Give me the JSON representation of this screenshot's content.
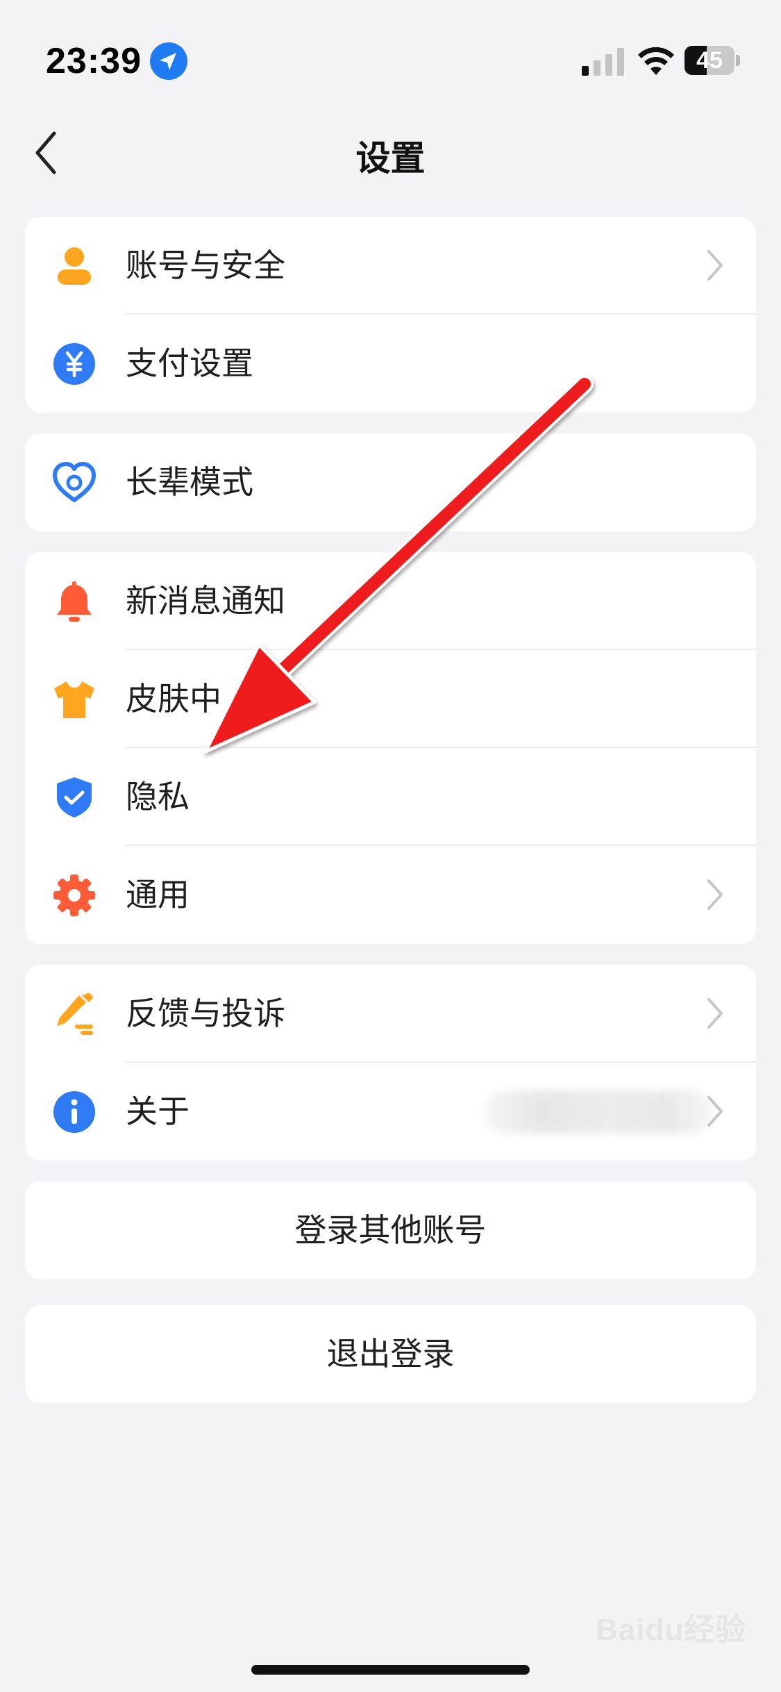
{
  "status_bar": {
    "time": "23:39",
    "battery_level": "45",
    "battery_fraction": 0.45,
    "icons": [
      "location-arrow-icon",
      "cellular-signal-icon",
      "wifi-icon",
      "battery-icon"
    ]
  },
  "nav": {
    "title": "设置",
    "back_icon": "chevron-left-icon"
  },
  "groups": [
    {
      "items": [
        {
          "label": "账号与安全",
          "icon": "person-icon",
          "icon_color": "#ffa51f",
          "chevron": true
        },
        {
          "label": "支付设置",
          "icon": "yuan-icon",
          "icon_color": "#2f7bf5",
          "chevron": false
        }
      ]
    },
    {
      "items": [
        {
          "label": "长辈模式",
          "icon": "heart-icon",
          "icon_color": "#2f7bf5",
          "chevron": false
        }
      ]
    },
    {
      "items": [
        {
          "label": "新消息通知",
          "icon": "bell-icon",
          "icon_color": "#ff5b36",
          "chevron": false
        },
        {
          "label": "皮肤中",
          "icon": "tshirt-icon",
          "icon_color": "#ffa51f",
          "chevron": false
        },
        {
          "label": "隐私",
          "icon": "shield-check-icon",
          "icon_color": "#2f7bf5",
          "chevron": false
        },
        {
          "label": "通用",
          "icon": "gear-icon",
          "icon_color": "#ff5b36",
          "chevron": true
        }
      ]
    },
    {
      "items": [
        {
          "label": "反馈与投诉",
          "icon": "pencil-icon",
          "icon_color": "#ffa51f",
          "chevron": true
        },
        {
          "label": "关于",
          "icon": "info-icon",
          "icon_color": "#2f7bf5",
          "chevron": true
        }
      ]
    }
  ],
  "buttons": {
    "switch_account": "登录其他账号",
    "logout": "退出登录"
  },
  "annotation": {
    "arrow_color": "#ee1c1c"
  },
  "watermark": {
    "text": "Baidu经验"
  }
}
